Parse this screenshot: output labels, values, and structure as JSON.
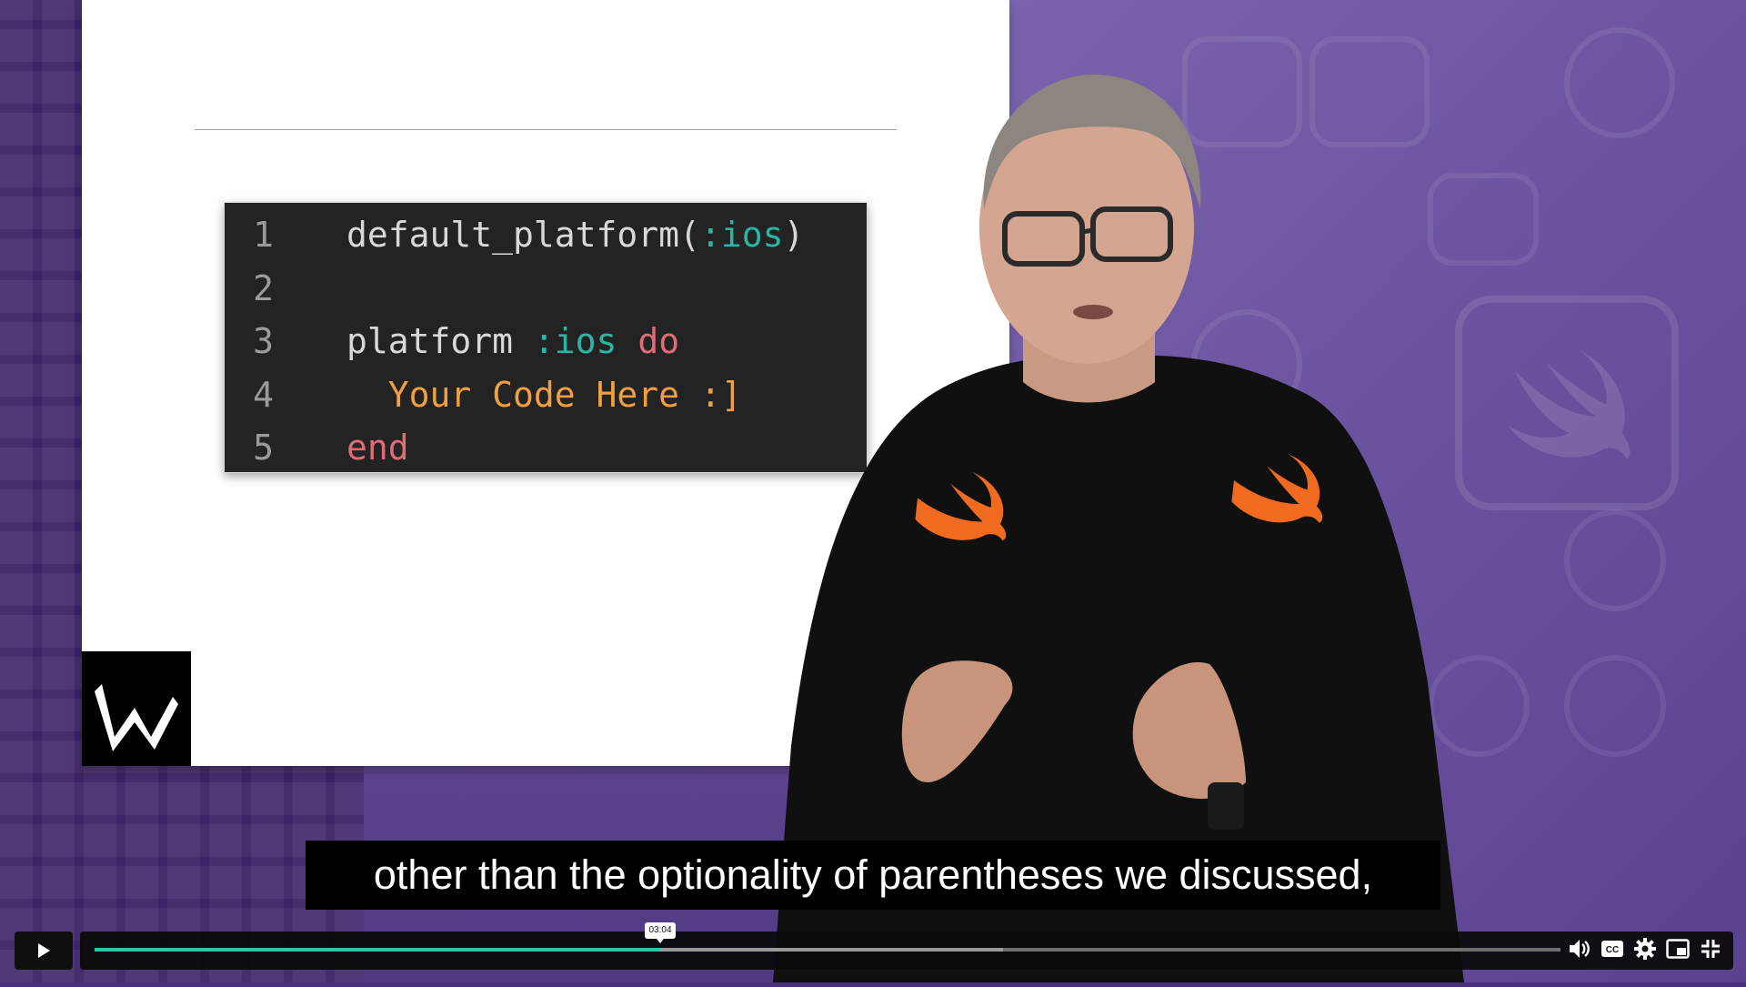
{
  "code_panel": {
    "lines": [
      {
        "number": "1",
        "parts": [
          {
            "t": "default_platform(",
            "c": "plain"
          },
          {
            "t": ":ios",
            "c": "sym"
          },
          {
            "t": ")",
            "c": "plain"
          }
        ]
      },
      {
        "number": "2",
        "parts": []
      },
      {
        "number": "3",
        "parts": [
          {
            "t": "platform ",
            "c": "plain"
          },
          {
            "t": ":ios",
            "c": "sym"
          },
          {
            "t": " ",
            "c": "plain"
          },
          {
            "t": "do",
            "c": "kw"
          }
        ]
      },
      {
        "number": "4",
        "parts": [
          {
            "t": "  Your Code Here :]",
            "c": "str"
          }
        ]
      },
      {
        "number": "5",
        "parts": [
          {
            "t": "end",
            "c": "kw"
          }
        ]
      }
    ]
  },
  "subtitle": {
    "text": "other than the optionality of parentheses we discussed,"
  },
  "player": {
    "time_tooltip": "03:04",
    "progress": 0.385,
    "buffered": 0.62,
    "icons": [
      "volume-icon",
      "captions-icon",
      "settings-icon",
      "pip-icon",
      "exit-fullscreen-icon"
    ],
    "accent": "#2ec4a7"
  }
}
